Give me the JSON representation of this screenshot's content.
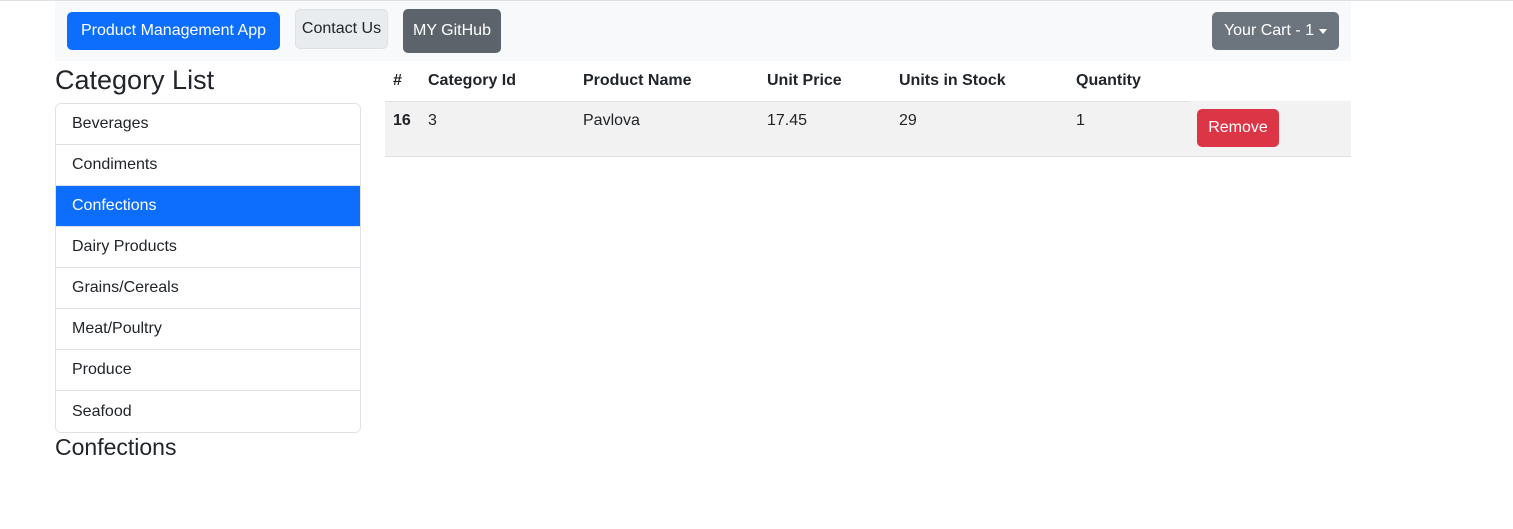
{
  "navbar": {
    "app_label": "Product Management App",
    "contact_label": "Contact Us",
    "github_label": "MY GitHub",
    "cart_label": "Your Cart - 1"
  },
  "sidebar": {
    "title": "Category List",
    "items": [
      {
        "label": "Beverages"
      },
      {
        "label": "Condiments"
      },
      {
        "label": "Confections"
      },
      {
        "label": "Dairy Products"
      },
      {
        "label": "Grains/Cereals"
      },
      {
        "label": "Meat/Poultry"
      },
      {
        "label": "Produce"
      },
      {
        "label": "Seafood"
      }
    ],
    "active_index": 2,
    "current_category": "Confections"
  },
  "cart_table": {
    "headers": [
      "#",
      "Category Id",
      "Product Name",
      "Unit Price",
      "Units in Stock",
      "Quantity"
    ],
    "rows": [
      {
        "id": "16",
        "category_id": "3",
        "product_name": "Pavlova",
        "unit_price": "17.45",
        "units_in_stock": "29",
        "quantity": "1",
        "action_label": "Remove"
      }
    ]
  },
  "colors": {
    "primary": "#0d6efd",
    "danger": "#dc3545",
    "secondary": "#6c757d",
    "navbar_bg": "#f8f9fa"
  }
}
